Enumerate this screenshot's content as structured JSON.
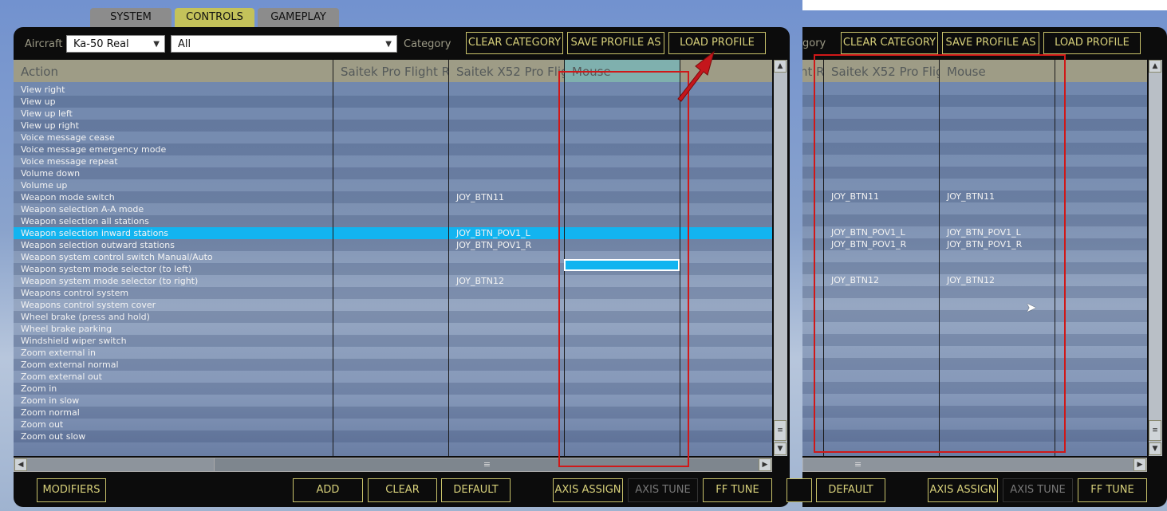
{
  "tabs": [
    {
      "label": "SYSTEM",
      "active": false
    },
    {
      "label": "CONTROLS",
      "active": true
    },
    {
      "label": "GAMEPLAY",
      "active": false
    }
  ],
  "toolbar": {
    "aircraft_label": "Aircraft",
    "aircraft_value": "Ka-50 Real",
    "filter_value": "All",
    "category_label": "Category",
    "clear_category": "CLEAR CATEGORY",
    "save_profile_as": "SAVE PROFILE AS",
    "load_profile": "LOAD PROFILE"
  },
  "columns": [
    "Action",
    "Saitek Pro Flight Ro",
    "Saitek X52 Pro Flig",
    "Mouse"
  ],
  "rows": [
    {
      "action": "View right",
      "x52": "",
      "mouse": ""
    },
    {
      "action": "View up",
      "x52": "",
      "mouse": ""
    },
    {
      "action": "View up left",
      "x52": "",
      "mouse": ""
    },
    {
      "action": "View up right",
      "x52": "",
      "mouse": ""
    },
    {
      "action": "Voice message cease",
      "x52": "",
      "mouse": ""
    },
    {
      "action": "Voice message emergency mode",
      "x52": "",
      "mouse": ""
    },
    {
      "action": "Voice message repeat",
      "x52": "",
      "mouse": ""
    },
    {
      "action": "Volume down",
      "x52": "",
      "mouse": ""
    },
    {
      "action": "Volume up",
      "x52": "",
      "mouse": ""
    },
    {
      "action": "Weapon mode switch",
      "x52": "JOY_BTN11",
      "mouse": "JOY_BTN11"
    },
    {
      "action": "Weapon selection A-A mode",
      "x52": "",
      "mouse": ""
    },
    {
      "action": "Weapon selection all stations",
      "x52": "",
      "mouse": ""
    },
    {
      "action": "Weapon selection inward stations",
      "x52": "JOY_BTN_POV1_L",
      "mouse": "JOY_BTN_POV1_L",
      "selected": true
    },
    {
      "action": "Weapon selection outward stations",
      "x52": "JOY_BTN_POV1_R",
      "mouse": "JOY_BTN_POV1_R"
    },
    {
      "action": "Weapon system control switch Manual/Auto",
      "x52": "",
      "mouse": ""
    },
    {
      "action": "Weapon system mode selector (to left)",
      "x52": "",
      "mouse": ""
    },
    {
      "action": "Weapon system mode selector (to right)",
      "x52": "JOY_BTN12",
      "mouse": "JOY_BTN12"
    },
    {
      "action": "Weapons control system",
      "x52": "",
      "mouse": ""
    },
    {
      "action": "Weapons control system cover",
      "x52": "",
      "mouse": ""
    },
    {
      "action": "Wheel brake (press and hold)",
      "x52": "",
      "mouse": ""
    },
    {
      "action": "Wheel brake parking",
      "x52": "",
      "mouse": ""
    },
    {
      "action": "Windshield wiper switch",
      "x52": "",
      "mouse": ""
    },
    {
      "action": "Zoom external in",
      "x52": "",
      "mouse": ""
    },
    {
      "action": "Zoom external normal",
      "x52": "",
      "mouse": ""
    },
    {
      "action": "Zoom external out",
      "x52": "",
      "mouse": ""
    },
    {
      "action": "Zoom in",
      "x52": "",
      "mouse": ""
    },
    {
      "action": "Zoom in slow",
      "x52": "",
      "mouse": ""
    },
    {
      "action": "Zoom normal",
      "x52": "",
      "mouse": ""
    },
    {
      "action": "Zoom out",
      "x52": "",
      "mouse": ""
    },
    {
      "action": "Zoom out slow",
      "x52": "",
      "mouse": ""
    }
  ],
  "right_panel": {
    "category_fragment": "gory",
    "col_fragment": "nt Rc",
    "columns": [
      "Saitek X52 Pro Flig",
      "Mouse"
    ]
  },
  "bottom": {
    "modifiers": "MODIFIERS",
    "add": "ADD",
    "clear": "CLEAR",
    "default": "DEFAULT",
    "axis_assign": "AXIS ASSIGN",
    "axis_tune": "AXIS TUNE",
    "ff_tune": "FF TUNE"
  },
  "scroll_glyph": "≡",
  "colors": {
    "accent": "#c4c25a",
    "selection": "#12b4f0",
    "highlight": "#d01818"
  }
}
